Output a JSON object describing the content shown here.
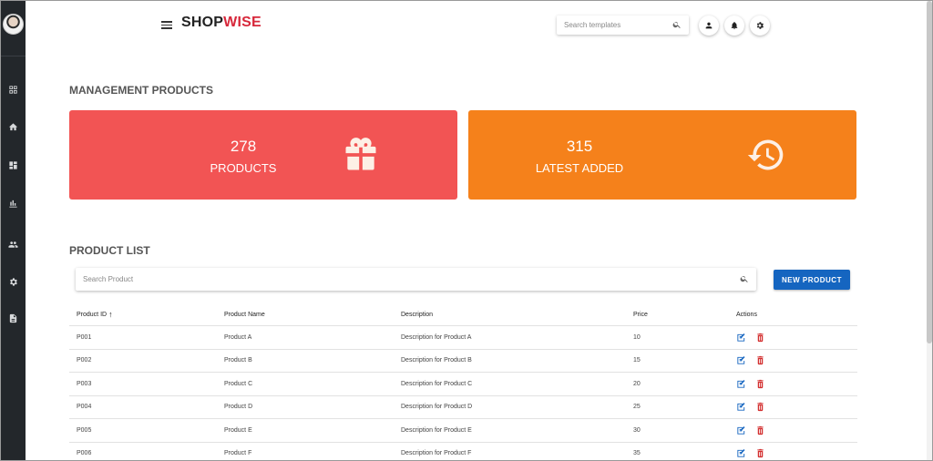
{
  "sidebar": {
    "items": [
      {
        "icon": "grid-icon"
      },
      {
        "icon": "home-icon"
      },
      {
        "icon": "dashboard-icon"
      },
      {
        "icon": "bar-chart-icon"
      },
      {
        "icon": "people-icon"
      },
      {
        "icon": "gear-icon"
      },
      {
        "icon": "document-icon"
      }
    ]
  },
  "header": {
    "logo_part1": "SHOP",
    "logo_part2": "WISE",
    "search_placeholder": "Search templates"
  },
  "main": {
    "title": "MANAGEMENT PRODUCTS",
    "cards": [
      {
        "value": "278",
        "label": "PRODUCTS",
        "color": "#f25454",
        "icon": "gift-icon"
      },
      {
        "value": "315",
        "label": "LATEST ADDED",
        "color": "#f5811b",
        "icon": "history-icon"
      }
    ],
    "list_title": "PRODUCT LIST",
    "search_placeholder": "Search Product",
    "new_button": "NEW PRODUCT",
    "table": {
      "headers": [
        "Product ID",
        "Product Name",
        "Description",
        "Price",
        "Actions"
      ],
      "rows": [
        {
          "id": "P001",
          "name": "Product A",
          "desc": "Description for Product A",
          "price": "10"
        },
        {
          "id": "P002",
          "name": "Product B",
          "desc": "Description for Product B",
          "price": "15"
        },
        {
          "id": "P003",
          "name": "Product C",
          "desc": "Description for Product C",
          "price": "20"
        },
        {
          "id": "P004",
          "name": "Product D",
          "desc": "Description for Product D",
          "price": "25"
        },
        {
          "id": "P005",
          "name": "Product E",
          "desc": "Description for Product E",
          "price": "30"
        },
        {
          "id": "P006",
          "name": "Product F",
          "desc": "Description for Product F",
          "price": "35"
        }
      ]
    }
  },
  "colors": {
    "accent": "#1565c0",
    "brand": "#d7283b",
    "delete": "#d32f2f"
  }
}
